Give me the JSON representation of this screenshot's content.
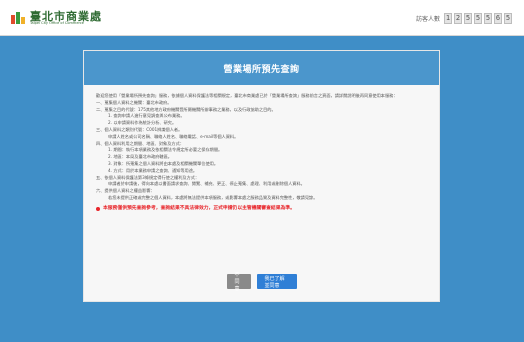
{
  "header": {
    "logo_text": "臺北市商業處",
    "logo_sub": "Taipei City Office of Commerce",
    "counter_label": "訪客人數",
    "counter_digits": [
      "1",
      "2",
      "5",
      "5",
      "5",
      "6",
      "5"
    ]
  },
  "card": {
    "title": "營業場所預先查詢",
    "paragraphs": [
      {
        "text": "歡迎您使用「營業場所預先查詢」服務，依據個人資料保護法等相關規定，臺北市商業處已於「營業場所查詢」服務前言之頁面，請詳閱說明後再同意使用本服務：",
        "indent": false
      },
      {
        "text": "一、蒐集個人資料之機關：臺北市政府。",
        "indent": false
      },
      {
        "text": "二、蒐集之目的代號：175其他地方政府機關暨所屬機關所辦事務之業務，以及行政協助之目的。",
        "indent": false
      },
      {
        "text": "1. 查詢申請人進行意見調查與公布業務。",
        "indent": true
      },
      {
        "text": "2. 以申請資料作為統計分析、研究。",
        "indent": true
      },
      {
        "text": "三、個人資料之類別代號：C001辨識個人者。",
        "indent": false
      },
      {
        "text": "申請人姓名或公司名稱、聯絡人姓名、聯絡電話、e-mail等個人資料。",
        "indent": true
      },
      {
        "text": "四、個人資料利用之期間、地區、對象及方式：",
        "indent": false
      },
      {
        "text": "1. 期間：執行本項業務及依相關法令規定所必要之保存期間。",
        "indent": true
      },
      {
        "text": "2. 地區：本局及臺北市政府轄區。",
        "indent": true
      },
      {
        "text": "3. 對象：所蒐集之個人資料將由本處及相關機關單位使用。",
        "indent": true
      },
      {
        "text": "4. 方式：用於本業務申請之查詢、通知等用途。",
        "indent": true
      },
      {
        "text": "五、依個人資料保護法第3條規定得行使之權利及方式：",
        "indent": false
      },
      {
        "text": "申請者於申請後，得向本處以書面請求查詢、閱覽、補充、更正、停止蒐集、處理、利用或刪除個人資料。",
        "indent": true
      },
      {
        "text": "六、提供個人資料之權益影響：",
        "indent": false
      },
      {
        "text": "若您未提供正確或完整之個人資料，本處將無法提供本項服務，或影響本處之服務品質及資料完整性，敬請見諒。",
        "indent": true
      }
    ],
    "warning": "本服務僅供預先查詢參考，查詢結果不具法律效力，正式申請仍以主管機關審查結果為準。",
    "decline_label": "不同意",
    "accept_label": "我已了解並同意"
  }
}
